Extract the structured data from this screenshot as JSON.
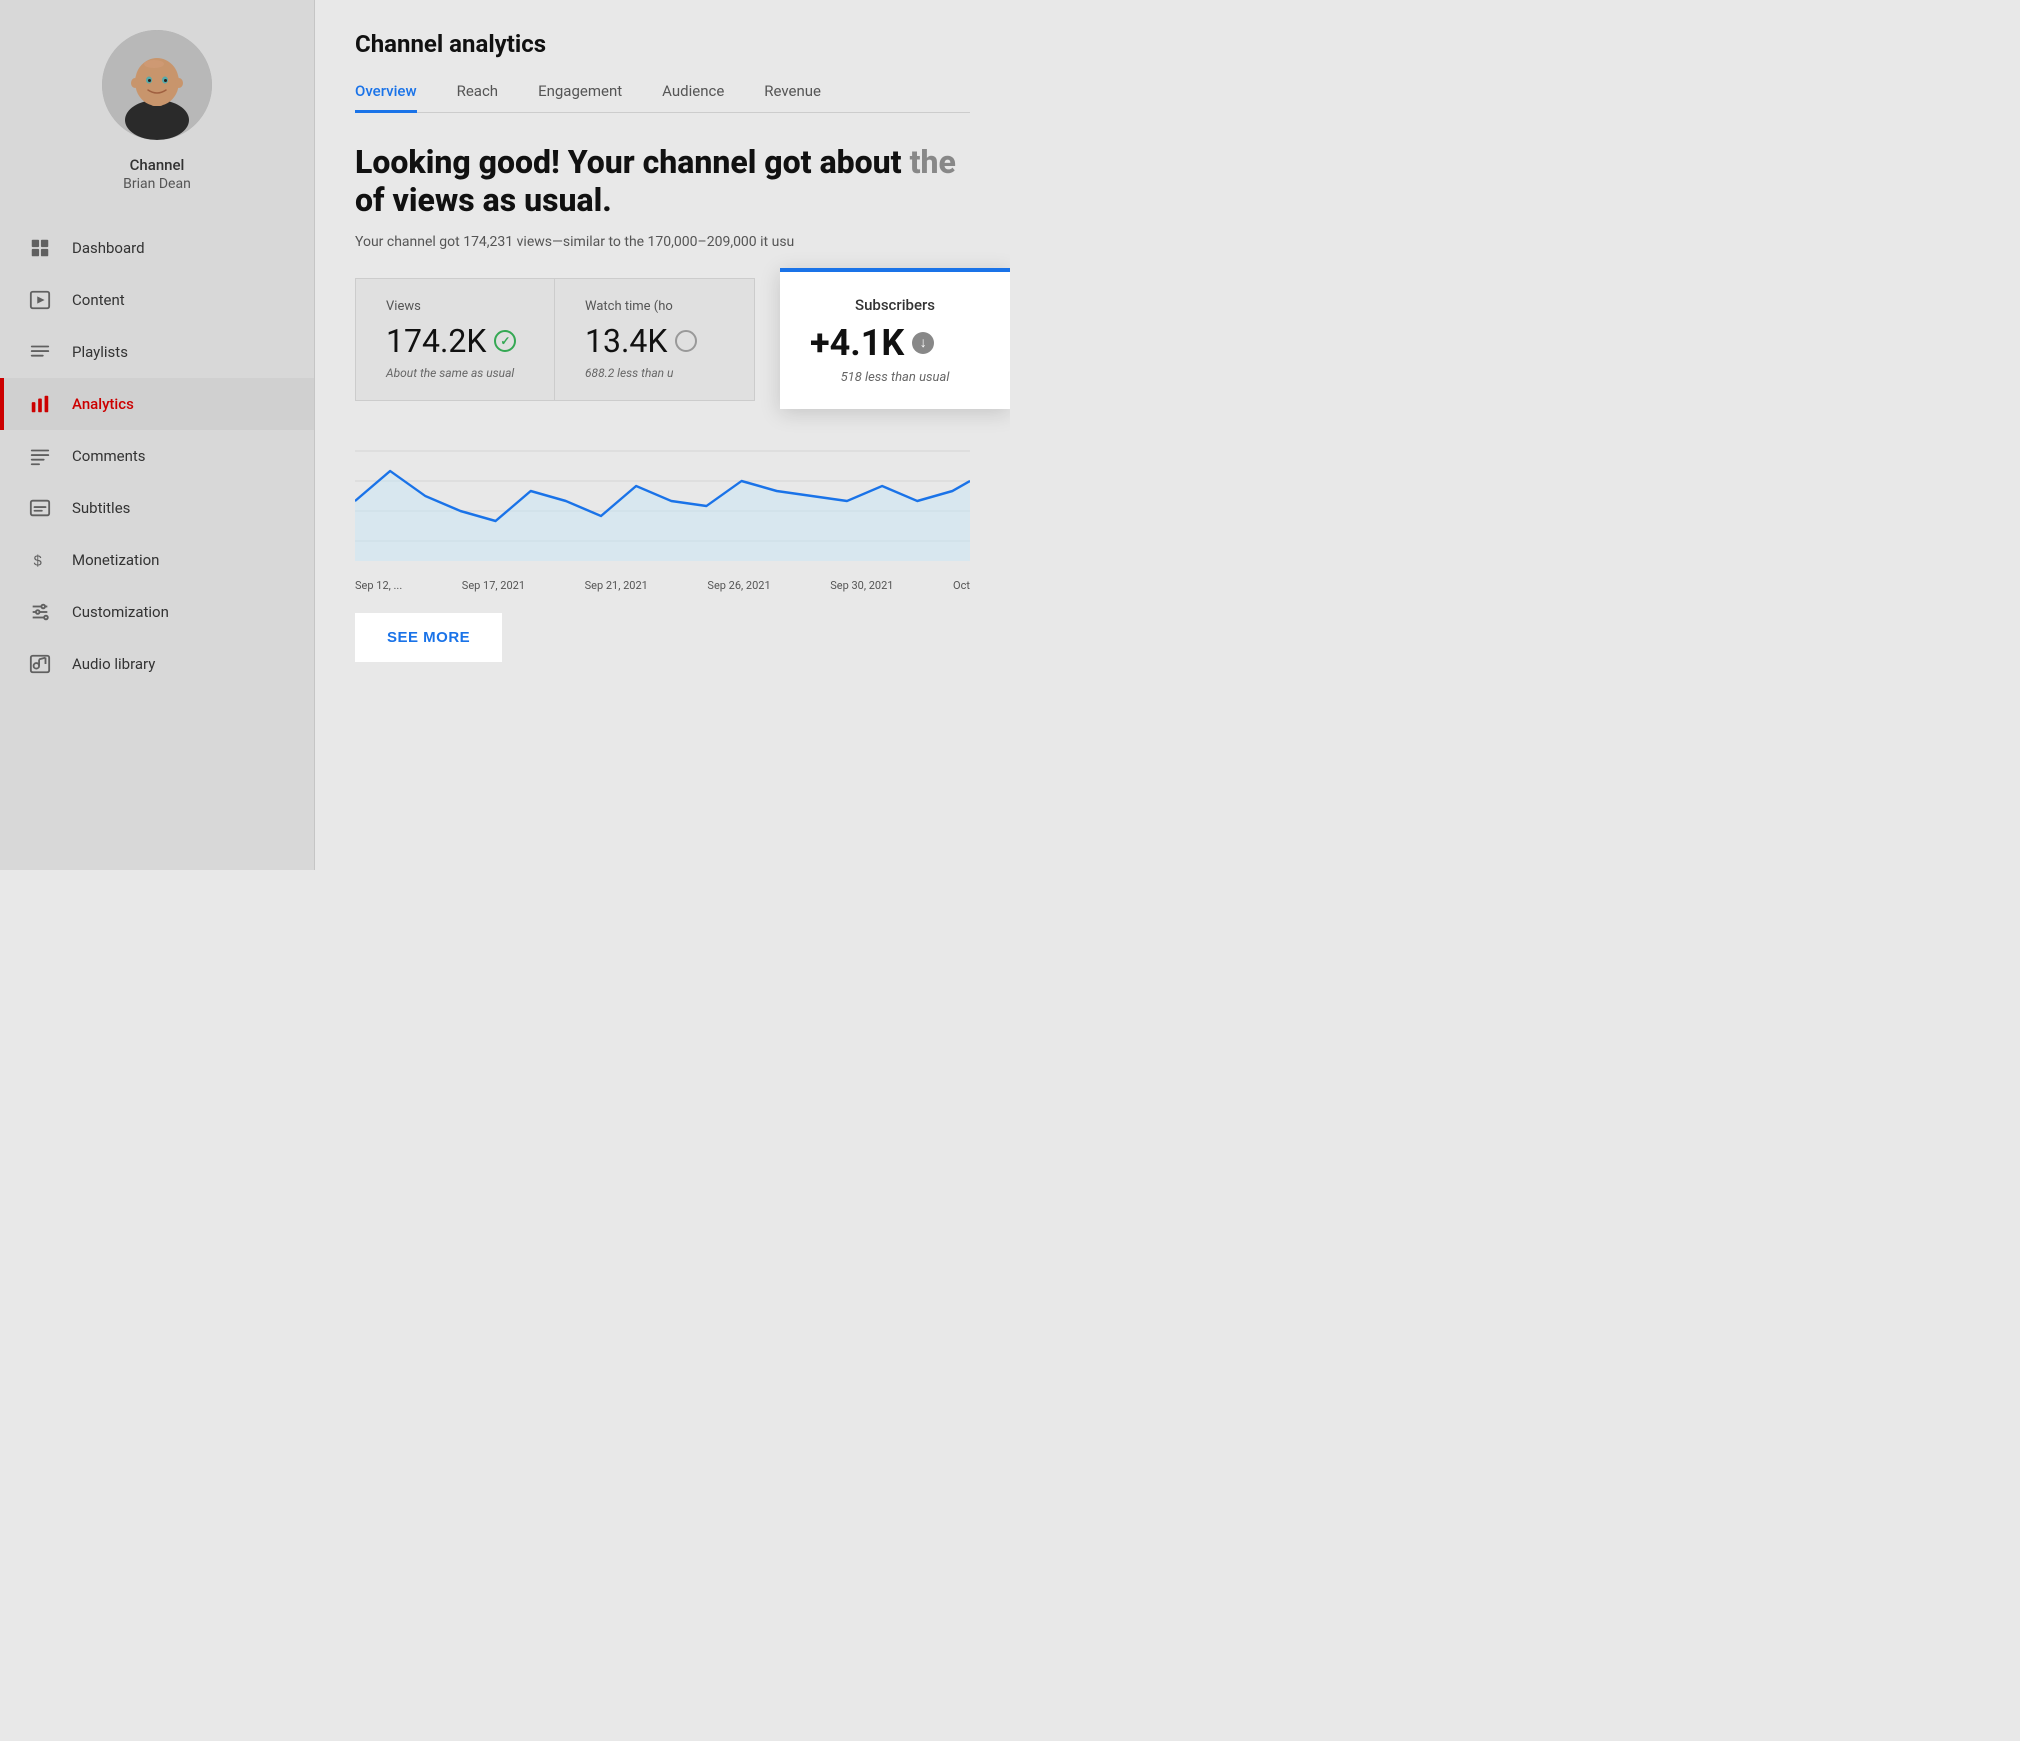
{
  "sidebar": {
    "channel_label": "Channel",
    "channel_name": "Brian Dean",
    "nav_items": [
      {
        "id": "dashboard",
        "label": "Dashboard",
        "active": false
      },
      {
        "id": "content",
        "label": "Content",
        "active": false
      },
      {
        "id": "playlists",
        "label": "Playlists",
        "active": false
      },
      {
        "id": "analytics",
        "label": "Analytics",
        "active": true
      },
      {
        "id": "comments",
        "label": "Comments",
        "active": false
      },
      {
        "id": "subtitles",
        "label": "Subtitles",
        "active": false
      },
      {
        "id": "monetization",
        "label": "Monetization",
        "active": false
      },
      {
        "id": "customization",
        "label": "Customization",
        "active": false
      },
      {
        "id": "audio-library",
        "label": "Audio library",
        "active": false
      }
    ]
  },
  "main": {
    "title": "Channel analytics",
    "tabs": [
      {
        "id": "overview",
        "label": "Overview",
        "active": true
      },
      {
        "id": "reach",
        "label": "Reach",
        "active": false
      },
      {
        "id": "engagement",
        "label": "Engagement",
        "active": false
      },
      {
        "id": "audience",
        "label": "Audience",
        "active": false
      },
      {
        "id": "revenue",
        "label": "Revenue",
        "active": false
      }
    ],
    "headline_part1": "Looking good! Your channel got about",
    "headline_part2": "the",
    "headline_part3": "of views as usual.",
    "subtext": "Your channel got 174,231 views—similar to the 170,000–209,000 it usu",
    "metrics": {
      "views": {
        "label": "Views",
        "value": "174.2K",
        "note": "About the same as usual"
      },
      "watch_time": {
        "label": "Watch time (ho",
        "value": "13.4K",
        "note": "688.2 less than u"
      },
      "subscribers": {
        "label": "Subscribers",
        "value": "+4.1K",
        "note": "518 less than usual"
      }
    },
    "chart_labels": [
      "Sep 12, ...",
      "Sep 17, 2021",
      "Sep 21, 2021",
      "Sep 26, 2021",
      "Sep 30, 2021",
      "Oct"
    ],
    "see_more_label": "SEE MORE"
  }
}
